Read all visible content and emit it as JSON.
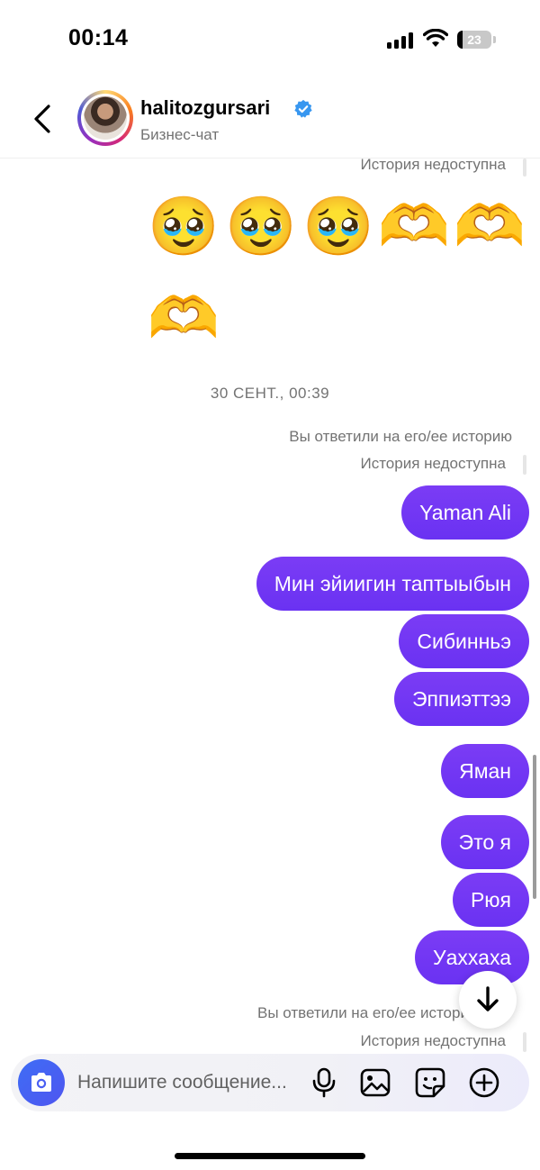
{
  "status_bar": {
    "time": "00:14",
    "battery": "23"
  },
  "header": {
    "username": "halitozgursari",
    "subtitle": "Бизнес-чат"
  },
  "thread": {
    "story_unavailable_top": "История недоступна",
    "reaction_emojis_row1": [
      "🥹",
      "🥹",
      "🥹",
      "🫶",
      "🫶"
    ],
    "reaction_emojis_row2": [
      "🫶"
    ],
    "date_separator": "30 СЕНТ., 00:39",
    "replied_story_1": "Вы ответили на его/ее историю",
    "story_unavailable_1": "История недоступна",
    "messages": [
      "Yaman Ali",
      "Мин эйиигин таптыыбын",
      "Сибинньэ",
      "Эппиэттээ",
      "Яман",
      "Это я",
      "Рюя",
      "Уаххаха"
    ],
    "replied_story_2": "Вы ответили на его/ее историю",
    "story_unavailable_2": "История недоступна"
  },
  "composer": {
    "placeholder": "Напишите сообщение..."
  },
  "icons": {
    "back": "chevron-left-icon",
    "verified": "verified-badge-icon",
    "camera": "camera-icon",
    "mic": "microphone-icon",
    "gallery": "image-icon",
    "sticker": "sticker-icon",
    "add": "plus-circle-icon",
    "scroll_down": "arrow-down-icon"
  },
  "colors": {
    "bubble": "#7036f3",
    "verified": "#3897f0",
    "camera_button": "#4a5ff2"
  }
}
